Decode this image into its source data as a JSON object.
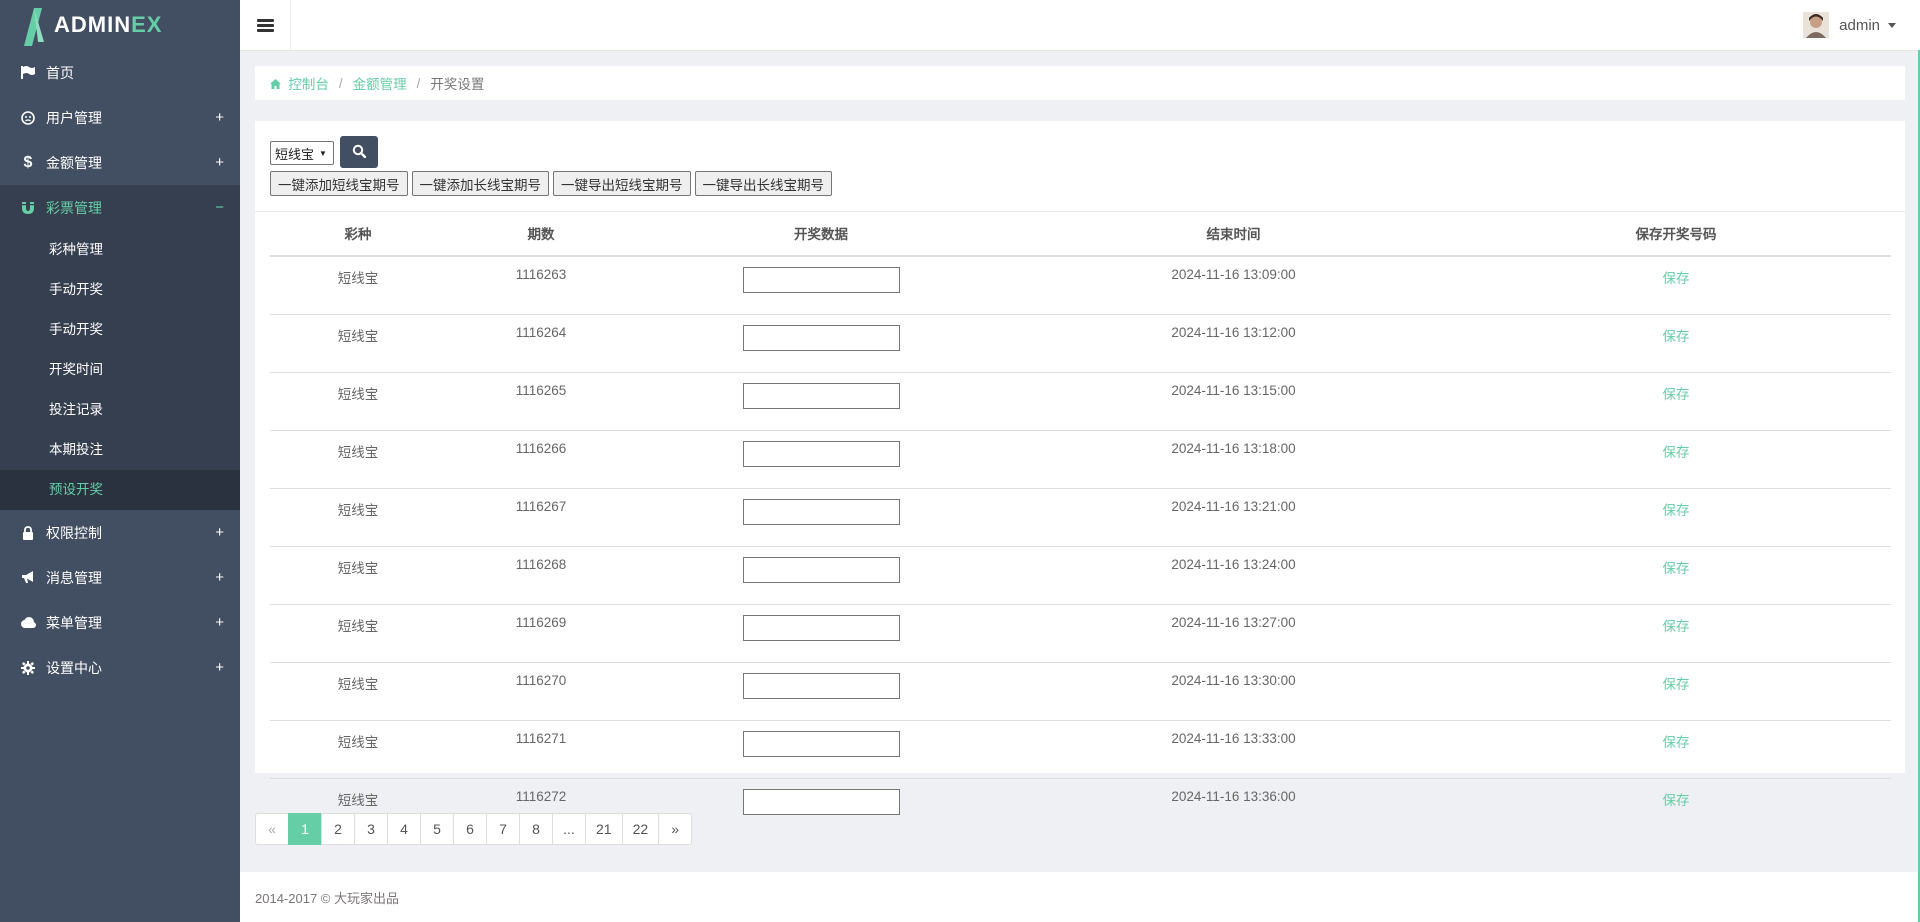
{
  "logo": {
    "part1": "ADMIN",
    "part2": "EX"
  },
  "sidebar": {
    "items": [
      {
        "label": "首页",
        "icon": "flag-icon",
        "toggle": ""
      },
      {
        "label": "用户管理",
        "icon": "user-circle-icon",
        "toggle": "+"
      },
      {
        "label": "金额管理",
        "icon": "dollar-icon",
        "toggle": "+"
      },
      {
        "label": "彩票管理",
        "icon": "magnet-icon",
        "toggle": "−",
        "sub": [
          "彩种管理",
          "手动开奖",
          "手动开奖",
          "开奖时间",
          "投注记录",
          "本期投注",
          "预设开奖"
        ]
      },
      {
        "label": "权限控制",
        "icon": "lock-icon",
        "toggle": "+"
      },
      {
        "label": "消息管理",
        "icon": "bullhorn-icon",
        "toggle": "+"
      },
      {
        "label": "菜单管理",
        "icon": "cloud-icon",
        "toggle": "+"
      },
      {
        "label": "设置中心",
        "icon": "gear-icon",
        "toggle": "+"
      }
    ]
  },
  "header": {
    "user_name": "admin"
  },
  "breadcrumb": {
    "home": "控制台",
    "level2": "金额管理",
    "current": "开奖设置"
  },
  "toolbar": {
    "select_value": "短线宝",
    "buttons": [
      "一键添加短线宝期号",
      "一键添加长线宝期号",
      "一键导出短线宝期号",
      "一键导出长线宝期号"
    ]
  },
  "table": {
    "headers": [
      "彩种",
      "期数",
      "开奖数据",
      "结束时间",
      "保存开奖号码"
    ],
    "save_label": "保存",
    "rows": [
      {
        "type": "短线宝",
        "period": "1116263",
        "end": "2024-11-16 13:09:00"
      },
      {
        "type": "短线宝",
        "period": "1116264",
        "end": "2024-11-16 13:12:00"
      },
      {
        "type": "短线宝",
        "period": "1116265",
        "end": "2024-11-16 13:15:00"
      },
      {
        "type": "短线宝",
        "period": "1116266",
        "end": "2024-11-16 13:18:00"
      },
      {
        "type": "短线宝",
        "period": "1116267",
        "end": "2024-11-16 13:21:00"
      },
      {
        "type": "短线宝",
        "period": "1116268",
        "end": "2024-11-16 13:24:00"
      },
      {
        "type": "短线宝",
        "period": "1116269",
        "end": "2024-11-16 13:27:00"
      },
      {
        "type": "短线宝",
        "period": "1116270",
        "end": "2024-11-16 13:30:00"
      },
      {
        "type": "短线宝",
        "period": "1116271",
        "end": "2024-11-16 13:33:00"
      },
      {
        "type": "短线宝",
        "period": "1116272",
        "end": "2024-11-16 13:36:00"
      }
    ]
  },
  "pagination": {
    "pages": [
      "«",
      "1",
      "2",
      "3",
      "4",
      "5",
      "6",
      "7",
      "8",
      "...",
      "21",
      "22",
      "»"
    ],
    "active": "1"
  },
  "footer": {
    "text": "2014-2017 © 大玩家出品"
  },
  "colors": {
    "accent": "#65cea7",
    "sidebar": "#424f63",
    "sidebar_active": "#353f4f"
  }
}
